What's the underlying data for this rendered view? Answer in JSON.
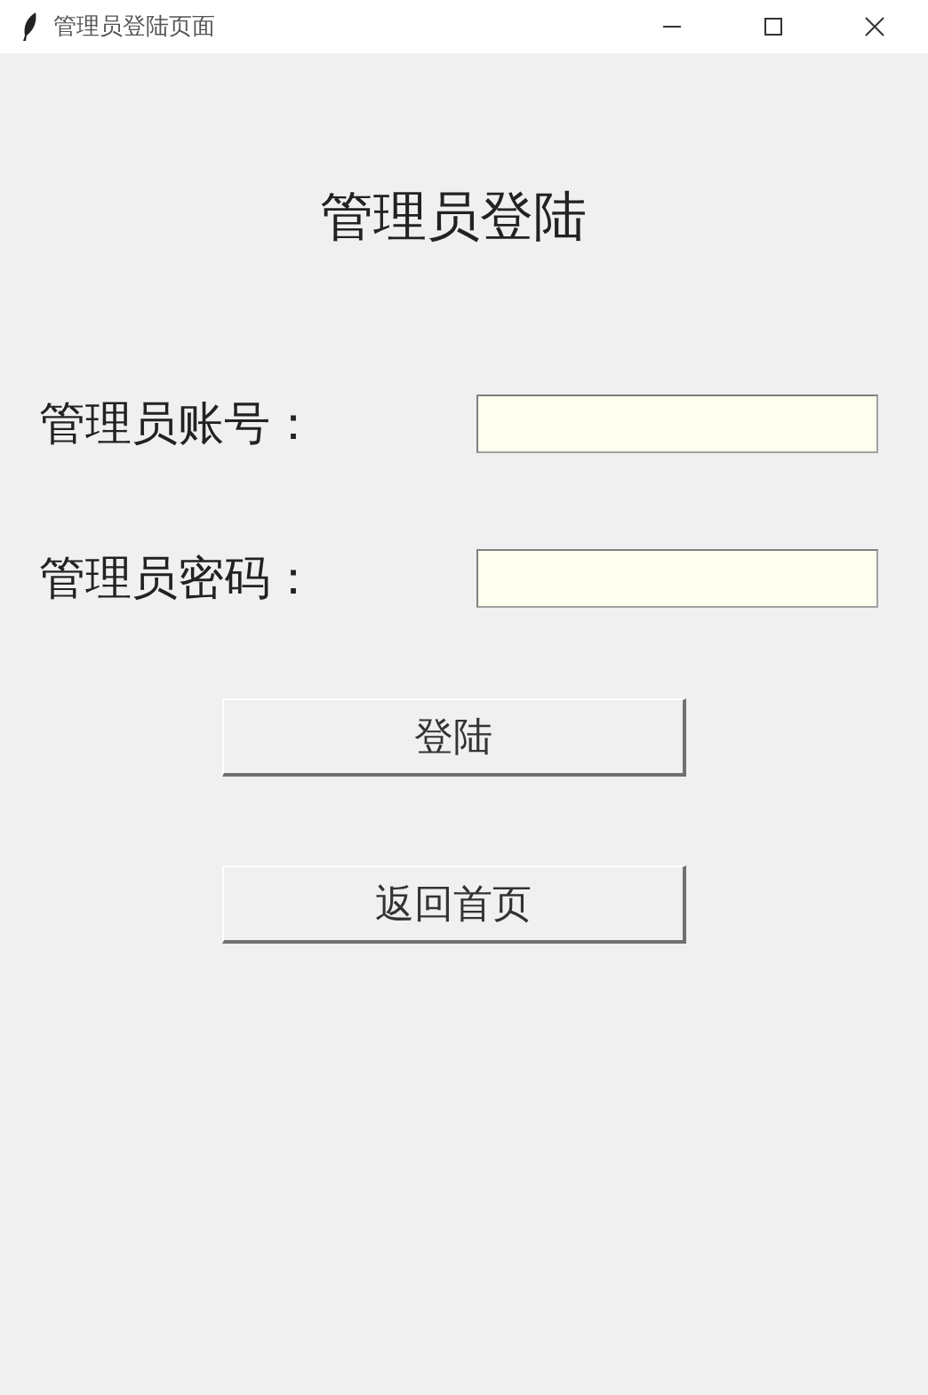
{
  "window": {
    "title": "管理员登陆页面"
  },
  "heading": "管理员登陆",
  "fields": [
    {
      "label": "管理员账号："
    },
    {
      "label": "管理员密码："
    }
  ],
  "buttons": [
    "登陆",
    "返回首页"
  ]
}
